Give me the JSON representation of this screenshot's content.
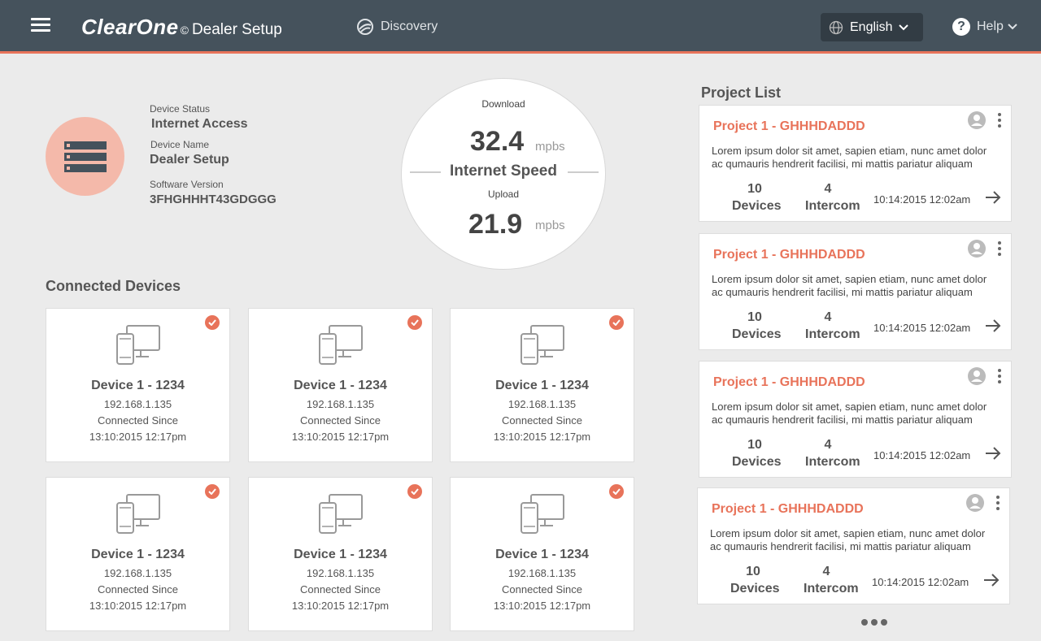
{
  "header": {
    "brand": "ClearOne",
    "copyright": "©",
    "app_title": "Dealer Setup",
    "discovery_label": "Discovery",
    "language": "English",
    "help_label": "Help",
    "accent_color": "#e8735a",
    "bar_color": "#45525c"
  },
  "device_info": {
    "status_label": "Device Status",
    "status_value": "Internet Access",
    "name_label": "Device Name",
    "name_value": "Dealer Setup",
    "version_label": "Software Version",
    "version_value": "3FHGHHHT43GDGGG"
  },
  "speed": {
    "download_label": "Download",
    "download_value": "32.4",
    "download_unit": "mpbs",
    "title": "Internet Speed",
    "upload_label": "Upload",
    "upload_value": "21.9",
    "upload_unit": "mpbs"
  },
  "connected_devices": {
    "title": "Connected Devices",
    "items": [
      {
        "name": "Device 1 - 1234",
        "ip": "192.168.1.135",
        "since_label": "Connected Since",
        "time": "13:10:2015 12:17pm"
      },
      {
        "name": "Device 1 - 1234",
        "ip": "192.168.1.135",
        "since_label": "Connected Since",
        "time": "13:10:2015 12:17pm"
      },
      {
        "name": "Device 1 - 1234",
        "ip": "192.168.1.135",
        "since_label": "Connected Since",
        "time": "13:10:2015 12:17pm"
      },
      {
        "name": "Device 1 - 1234",
        "ip": "192.168.1.135",
        "since_label": "Connected Since",
        "time": "13:10:2015 12:17pm"
      },
      {
        "name": "Device 1 - 1234",
        "ip": "192.168.1.135",
        "since_label": "Connected Since",
        "time": "13:10:2015 12:17pm"
      },
      {
        "name": "Device 1 - 1234",
        "ip": "192.168.1.135",
        "since_label": "Connected Since",
        "time": "13:10:2015 12:17pm"
      }
    ]
  },
  "project_list": {
    "title": "Project List",
    "items": [
      {
        "title": "Project 1 - GHHHDADDD",
        "description": "Lorem ipsum dolor sit amet, sapien etiam, nunc amet dolor ac qumauris hendrerit facilisi, mi mattis pariatur aliquam",
        "devices_count": "10",
        "devices_label": "Devices",
        "intercom_count": "4",
        "intercom_label": "Intercom",
        "date": "10:14:2015 12:02am"
      },
      {
        "title": "Project 1 - GHHHDADDD",
        "description": "Lorem ipsum dolor sit amet, sapien etiam, nunc amet dolor ac qumauris hendrerit facilisi, mi mattis pariatur aliquam",
        "devices_count": "10",
        "devices_label": "Devices",
        "intercom_count": "4",
        "intercom_label": "Intercom",
        "date": "10:14:2015 12:02am"
      },
      {
        "title": "Project 1 - GHHHDADDD",
        "description": "Lorem ipsum dolor sit amet, sapien etiam, nunc amet dolor ac qumauris hendrerit facilisi, mi mattis pariatur aliquam",
        "devices_count": "10",
        "devices_label": "Devices",
        "intercom_count": "4",
        "intercom_label": "Intercom",
        "date": "10:14:2015 12:02am"
      },
      {
        "title": "Project 1 - GHHHDADDD",
        "description": "Lorem ipsum dolor sit amet, sapien etiam, nunc amet dolor ac qumauris hendrerit facilisi, mi mattis pariatur aliquam",
        "devices_count": "10",
        "devices_label": "Devices",
        "intercom_count": "4",
        "intercom_label": "Intercom",
        "date": "10:14:2015 12:02am"
      }
    ]
  }
}
